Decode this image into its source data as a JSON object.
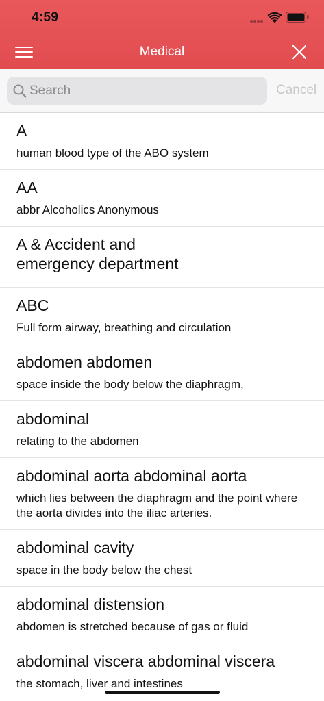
{
  "status_bar": {
    "time": "4:59"
  },
  "nav": {
    "title": "Medical",
    "left_icon": "menu-icon",
    "right_icon": "close-icon"
  },
  "search": {
    "placeholder": "Search",
    "value": "",
    "cancel_label": "Cancel"
  },
  "colors": {
    "header": "#e14c4f",
    "search_bg": "#e4e4e6",
    "cancel_text": "#c8c8c8"
  },
  "entries": [
    {
      "term": "A",
      "definition": "human blood type of the ABO system"
    },
    {
      "term": "AA",
      "definition": "abbr Alcoholics Anonymous"
    },
    {
      "term": "A & Accident and emergency department",
      "definition": ""
    },
    {
      "term": "ABC",
      "definition": "Full form airway, breathing and circulation"
    },
    {
      "term": "abdomen abdomen",
      "definition": "space inside the body below the diaphragm,"
    },
    {
      "term": "abdominal",
      "definition": "relating to the abdomen"
    },
    {
      "term": "abdominal aorta abdominal aorta",
      "definition": "which lies between the diaphragm and the point where the aorta divides into the iliac arteries."
    },
    {
      "term": "abdominal cavity",
      "definition": "space in the body below the chest"
    },
    {
      "term": "abdominal distension",
      "definition": "abdomen is stretched because of gas or fluid"
    },
    {
      "term": "abdominal viscera abdominal viscera",
      "definition": "the stomach, liver and intestines"
    }
  ]
}
